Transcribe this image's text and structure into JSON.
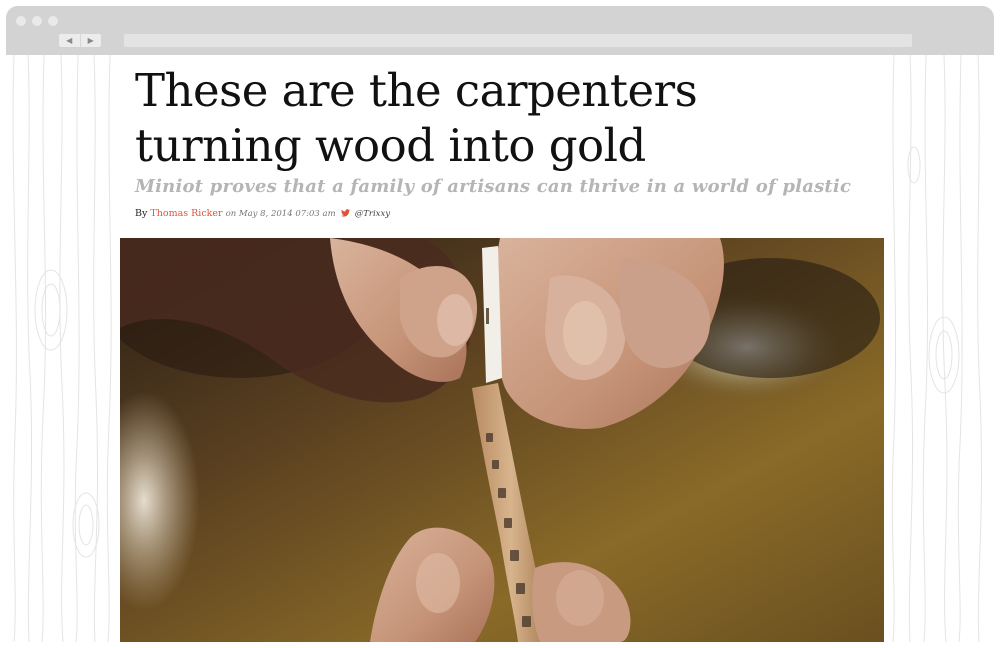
{
  "browser": {
    "back_icon": "◀",
    "forward_icon": "▶"
  },
  "article": {
    "headline": "These are the carpenters turning wood into gold",
    "dek": "Miniot proves that a family of artisans can thrive in a world of plastic",
    "byline": {
      "prefix": "By",
      "author": "Thomas Ricker",
      "date_text": "on May 8, 2014 07:03 am",
      "twitter_icon": "twitter-bird-icon",
      "handle": "@Trixxy"
    },
    "hero_image": "hands-holding-wooden-strip-photo"
  },
  "colors": {
    "author": "#e0533a",
    "dek": "#b5b5b5",
    "chrome": "#d3d3d3"
  }
}
